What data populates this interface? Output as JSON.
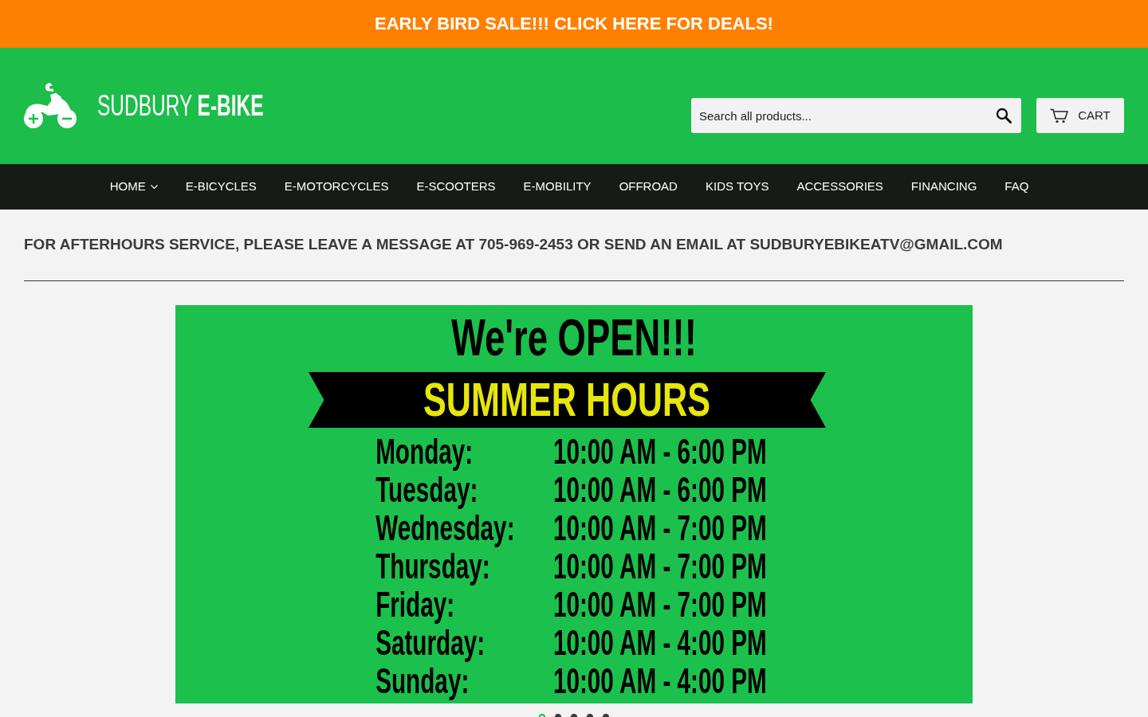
{
  "promo_bar": {
    "text": "EARLY BIRD SALE!!! CLICK HERE FOR DEALS!"
  },
  "header": {
    "logo_text": "SUDBURY **E-BIKE**",
    "search": {
      "placeholder": "Search all products..."
    },
    "cart": {
      "label": "CART"
    }
  },
  "nav": {
    "items": [
      {
        "label": "HOME",
        "dropdown": true
      },
      {
        "label": "E-BICYCLES",
        "dropdown": false
      },
      {
        "label": "E-MOTORCYCLES",
        "dropdown": false
      },
      {
        "label": "E-SCOOTERS",
        "dropdown": false
      },
      {
        "label": "E-MOBILITY",
        "dropdown": false
      },
      {
        "label": "OFFROAD",
        "dropdown": false
      },
      {
        "label": "KIDS TOYS",
        "dropdown": false
      },
      {
        "label": "ACCESSORIES",
        "dropdown": false
      },
      {
        "label": "FINANCING",
        "dropdown": false
      },
      {
        "label": "FAQ",
        "dropdown": false
      }
    ]
  },
  "notice": "FOR AFTERHOURS SERVICE, PLEASE LEAVE A MESSAGE AT 705-969-2453 OR SEND AN EMAIL AT SUDBURYEBIKEATV@GMAIL.COM",
  "slideshow": {
    "slide": {
      "headline": "We're OPEN!!!",
      "ribbon": "SUMMER HOURS",
      "hours": [
        {
          "day": "Monday:",
          "time": "10:00 AM - 6:00 PM"
        },
        {
          "day": "Tuesday:",
          "time": "10:00 AM - 6:00 PM"
        },
        {
          "day": "Wednesday:",
          "time": "10:00 AM - 7:00 PM"
        },
        {
          "day": "Thursday:",
          "time": "10:00 AM - 7:00 PM"
        },
        {
          "day": "Friday:",
          "time": "10:00 AM - 7:00 PM"
        },
        {
          "day": "Saturday:",
          "time": "10:00 AM - 4:00 PM"
        },
        {
          "day": "Sunday:",
          "time": "10:00 AM - 4:00 PM"
        }
      ]
    },
    "dots": [
      {
        "selected": true
      },
      {
        "selected": false
      },
      {
        "selected": false
      },
      {
        "selected": false
      },
      {
        "selected": false
      }
    ]
  }
}
